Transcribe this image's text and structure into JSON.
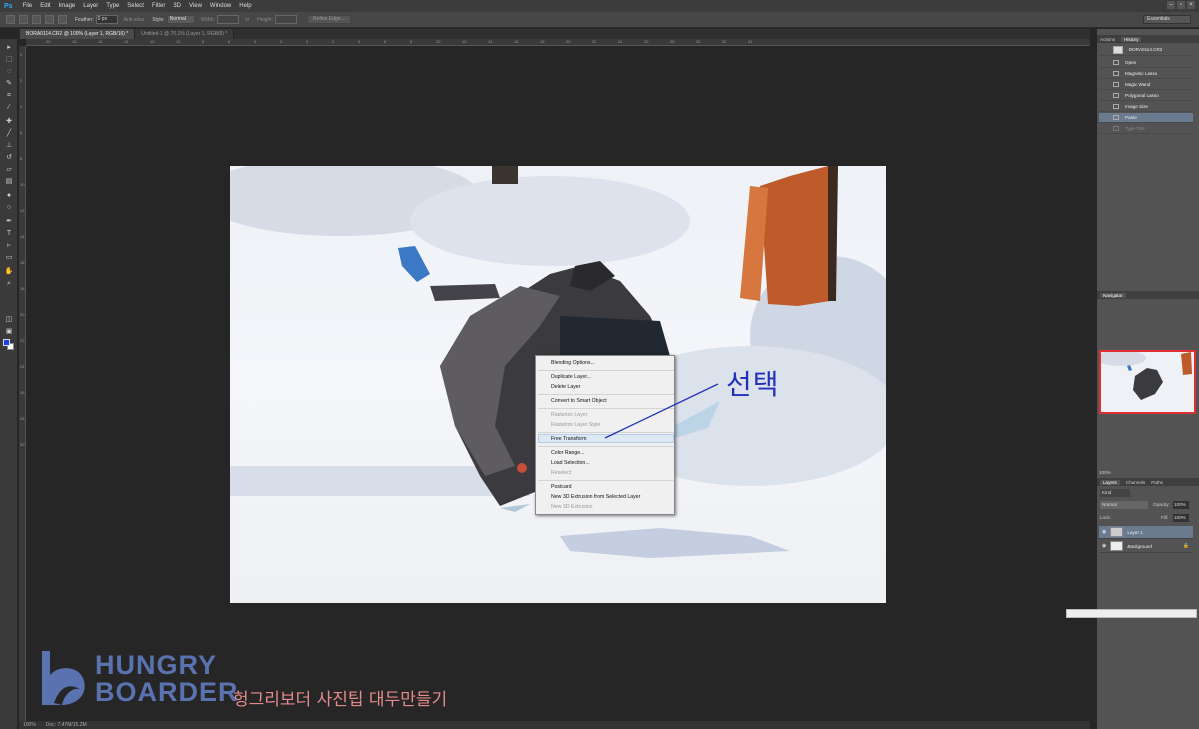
{
  "menubar": {
    "logo": "Ps",
    "items": [
      "File",
      "Edit",
      "Image",
      "Layer",
      "Type",
      "Select",
      "Filter",
      "3D",
      "View",
      "Window",
      "Help"
    ],
    "window_controls": [
      "–",
      "▫",
      "×"
    ]
  },
  "options_bar": {
    "feather_label": "Feather:",
    "feather_value": "0 px",
    "anti_alias_label": "Anti-alias",
    "style_label": "Style:",
    "style_value": "Normal",
    "width_label": "Width:",
    "height_label": "Height:",
    "refine_edge_label": "Refine Edge...",
    "workspace": "Essentials"
  },
  "tabs": [
    {
      "label": "BORA0114.CR2 @ 100% (Layer 1, RGB/16) *",
      "active": true
    },
    {
      "label": "Untitled-1 @ 70.1% (Layer 1, RGB/8) *",
      "active": false
    }
  ],
  "ruler_ticks": [
    "20",
    "18",
    "16",
    "14",
    "12",
    "10",
    "8",
    "6",
    "4",
    "2",
    "0",
    "2",
    "4",
    "6",
    "8",
    "10",
    "12",
    "14",
    "16",
    "18",
    "20",
    "22",
    "24",
    "26",
    "28",
    "30",
    "32",
    "34"
  ],
  "ruler_vticks": [
    "0",
    "2",
    "4",
    "6",
    "8",
    "10",
    "12",
    "14",
    "16",
    "18",
    "20",
    "22",
    "24",
    "26",
    "28",
    "30"
  ],
  "context_menu": {
    "items": [
      {
        "label": "Blending Options...",
        "disabled": false
      },
      {
        "label": "Duplicate Layer...",
        "disabled": false
      },
      {
        "label": "Delete Layer",
        "disabled": false
      },
      {
        "label": "Convert to Smart Object",
        "disabled": false
      },
      {
        "label": "Rasterize Layer",
        "disabled": true
      },
      {
        "label": "Rasterize Layer Style",
        "disabled": true
      },
      {
        "label": "Free Transform",
        "disabled": false
      },
      {
        "label": "Color Range...",
        "disabled": false
      },
      {
        "label": "Load Selection...",
        "disabled": false
      },
      {
        "label": "Reselect",
        "disabled": true
      },
      {
        "label": "Postcard",
        "disabled": false
      },
      {
        "label": "New 3D Extrusion from Selected Layer",
        "disabled": false
      },
      {
        "label": "New 3D Extrusion",
        "disabled": true
      }
    ],
    "highlighted": "Free Transform"
  },
  "annotation": "선택",
  "right_panel": {
    "top_tabs": [
      "Actions",
      "History"
    ],
    "history_snapshot": "BORA0114.CR2",
    "history": [
      {
        "label": "Open",
        "selected": false,
        "dimmed": false
      },
      {
        "label": "Magnetic Lasso",
        "selected": false,
        "dimmed": false
      },
      {
        "label": "Magic Wand",
        "selected": false,
        "dimmed": false
      },
      {
        "label": "Polygonal Lasso",
        "selected": false,
        "dimmed": false
      },
      {
        "label": "Image Size",
        "selected": false,
        "dimmed": false
      },
      {
        "label": "Paste",
        "selected": true,
        "dimmed": false
      },
      {
        "label": "Type Tool",
        "selected": false,
        "dimmed": true
      }
    ],
    "navigator_title": "Navigator",
    "navigator_zoom": "100%",
    "layer_tabs": [
      "Layers",
      "Channels",
      "Paths"
    ],
    "kind_label": "Kind",
    "blend_mode": "Normal",
    "opacity_label": "Opacity:",
    "opacity_value": "100%",
    "lock_label": "Lock:",
    "fill_label": "Fill:",
    "fill_value": "100%",
    "layers": [
      {
        "name": "Layer 1",
        "selected": true
      },
      {
        "name": "Background",
        "selected": false
      }
    ]
  },
  "status": {
    "zoom": "100%",
    "doc": "Doc: 7.47M/15.2M"
  },
  "watermark": {
    "line1": "HUNGRY",
    "line2": "BOARDER",
    "subtitle": "헝그리보더 사진팁 대두만들기"
  },
  "colors": {
    "foreground": "#1a3cf0",
    "background": "#ffffff",
    "annotation": "#2330b8",
    "logo": "#5a72b0",
    "subtitle": "#e58b8b"
  }
}
